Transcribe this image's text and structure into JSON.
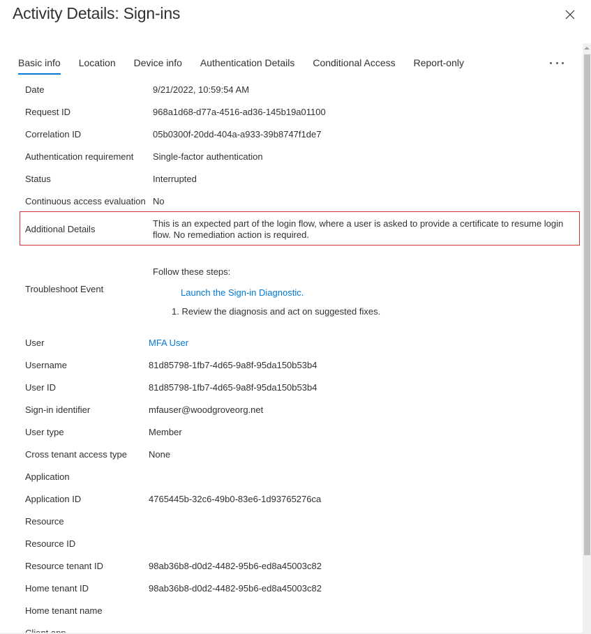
{
  "header": {
    "title": "Activity Details: Sign-ins",
    "close_icon": "close-icon"
  },
  "tabs": [
    {
      "label": "Basic info",
      "active": true
    },
    {
      "label": "Location",
      "active": false
    },
    {
      "label": "Device info",
      "active": false
    },
    {
      "label": "Authentication Details",
      "active": false
    },
    {
      "label": "Conditional Access",
      "active": false
    },
    {
      "label": "Report-only",
      "active": false
    }
  ],
  "more_icon": "more-ellipsis-icon",
  "details_top": [
    {
      "label": "Date",
      "value": "9/21/2022, 10:59:54 AM"
    },
    {
      "label": "Request ID",
      "value": "968a1d68-d77a-4516-ad36-145b19a01100"
    },
    {
      "label": "Correlation ID",
      "value": "05b0300f-20dd-404a-a933-39b8747f1de7"
    },
    {
      "label": "Authentication requirement",
      "value": "Single-factor authentication"
    },
    {
      "label": "Status",
      "value": "Interrupted"
    },
    {
      "label": "Continuous access evaluation",
      "value": "No"
    }
  ],
  "additional_details": {
    "label": "Additional Details",
    "value": "This is an expected part of the login flow, where a user is asked to provide a certificate to resume login flow. No remediation action is required.",
    "highlight_color": "#d13438"
  },
  "troubleshoot": {
    "label": "Troubleshoot Event",
    "intro": "Follow these steps:",
    "link": "Launch the Sign-in Diagnostic.",
    "steps": [
      "1. Review the diagnosis and act on suggested fixes."
    ]
  },
  "details_bottom": [
    {
      "label": "User",
      "value": "MFA User",
      "is_link": true
    },
    {
      "label": "Username",
      "value": "81d85798-1fb7-4d65-9a8f-95da150b53b4"
    },
    {
      "label": "User ID",
      "value": "81d85798-1fb7-4d65-9a8f-95da150b53b4"
    },
    {
      "label": "Sign-in identifier",
      "value": "mfauser@woodgroveorg.net"
    },
    {
      "label": "User type",
      "value": "Member"
    },
    {
      "label": "Cross tenant access type",
      "value": "None"
    },
    {
      "label": "Application",
      "value": ""
    },
    {
      "label": "Application ID",
      "value": "4765445b-32c6-49b0-83e6-1d93765276ca"
    },
    {
      "label": "Resource",
      "value": ""
    },
    {
      "label": "Resource ID",
      "value": ""
    },
    {
      "label": "Resource tenant ID",
      "value": "98ab36b8-d0d2-4482-95b6-ed8a45003c82"
    },
    {
      "label": "Home tenant ID",
      "value": "98ab36b8-d0d2-4482-95b6-ed8a45003c82"
    },
    {
      "label": "Home tenant name",
      "value": ""
    },
    {
      "label": "Client app",
      "value": ""
    }
  ],
  "colors": {
    "accent": "#0078d4",
    "text": "#323130",
    "highlight_border": "#d13438"
  }
}
